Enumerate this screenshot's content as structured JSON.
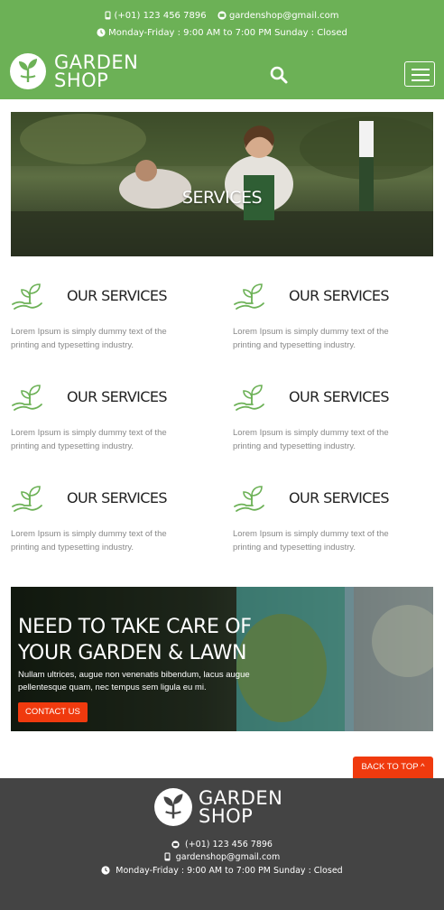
{
  "header": {
    "phone": "(+01) 123 456 7896",
    "email": "gardenshop@gmail.com",
    "hours": "Monday-Friday : 9:00 AM to 7:00 PM Sunday : Closed",
    "logo_line1": "GARDEN",
    "logo_line2": "SHOP"
  },
  "hero": {
    "title": "SERVICES"
  },
  "services": [
    {
      "title": "OUR SERVICES",
      "text": "Lorem Ipsum is simply dummy text of the printing and typesetting industry."
    },
    {
      "title": "OUR SERVICES",
      "text": "Lorem Ipsum is simply dummy text of the printing and typesetting industry."
    },
    {
      "title": "OUR SERVICES",
      "text": "Lorem Ipsum is simply dummy text of the printing and typesetting industry."
    },
    {
      "title": "OUR SERVICES",
      "text": "Lorem Ipsum is simply dummy text of the printing and typesetting industry."
    },
    {
      "title": "OUR SERVICES",
      "text": "Lorem Ipsum is simply dummy text of the printing and typesetting industry."
    },
    {
      "title": "OUR SERVICES",
      "text": "Lorem Ipsum is simply dummy text of the printing and typesetting industry."
    }
  ],
  "cta": {
    "title_line1": "NEED TO TAKE CARE OF",
    "title_line2": "YOUR GARDEN & LAWN",
    "text": "Nullam ultrices, augue non venenatis bibendum, lacus augue pellentesque quam, nec tempus sem ligula eu mi.",
    "button": "CONTACT US"
  },
  "back_to_top": "BACK TO TOP ^",
  "footer": {
    "logo_line1": "GARDEN",
    "logo_line2": "SHOP",
    "phone": "(+01) 123 456 7896",
    "email": "gardenshop@gmail.com",
    "hours": "Monday-Friday : 9:00 AM to 7:00 PM Sunday : Closed"
  },
  "colors": {
    "brand_green": "#6cb156",
    "accent_orange": "#f03a0e",
    "footer_bg": "#444444"
  },
  "icons": {
    "phone": "phone-icon",
    "email": "email-icon",
    "clock": "clock-icon",
    "search": "search-icon",
    "menu": "hamburger-menu-icon",
    "service": "plant-in-hand-icon"
  }
}
